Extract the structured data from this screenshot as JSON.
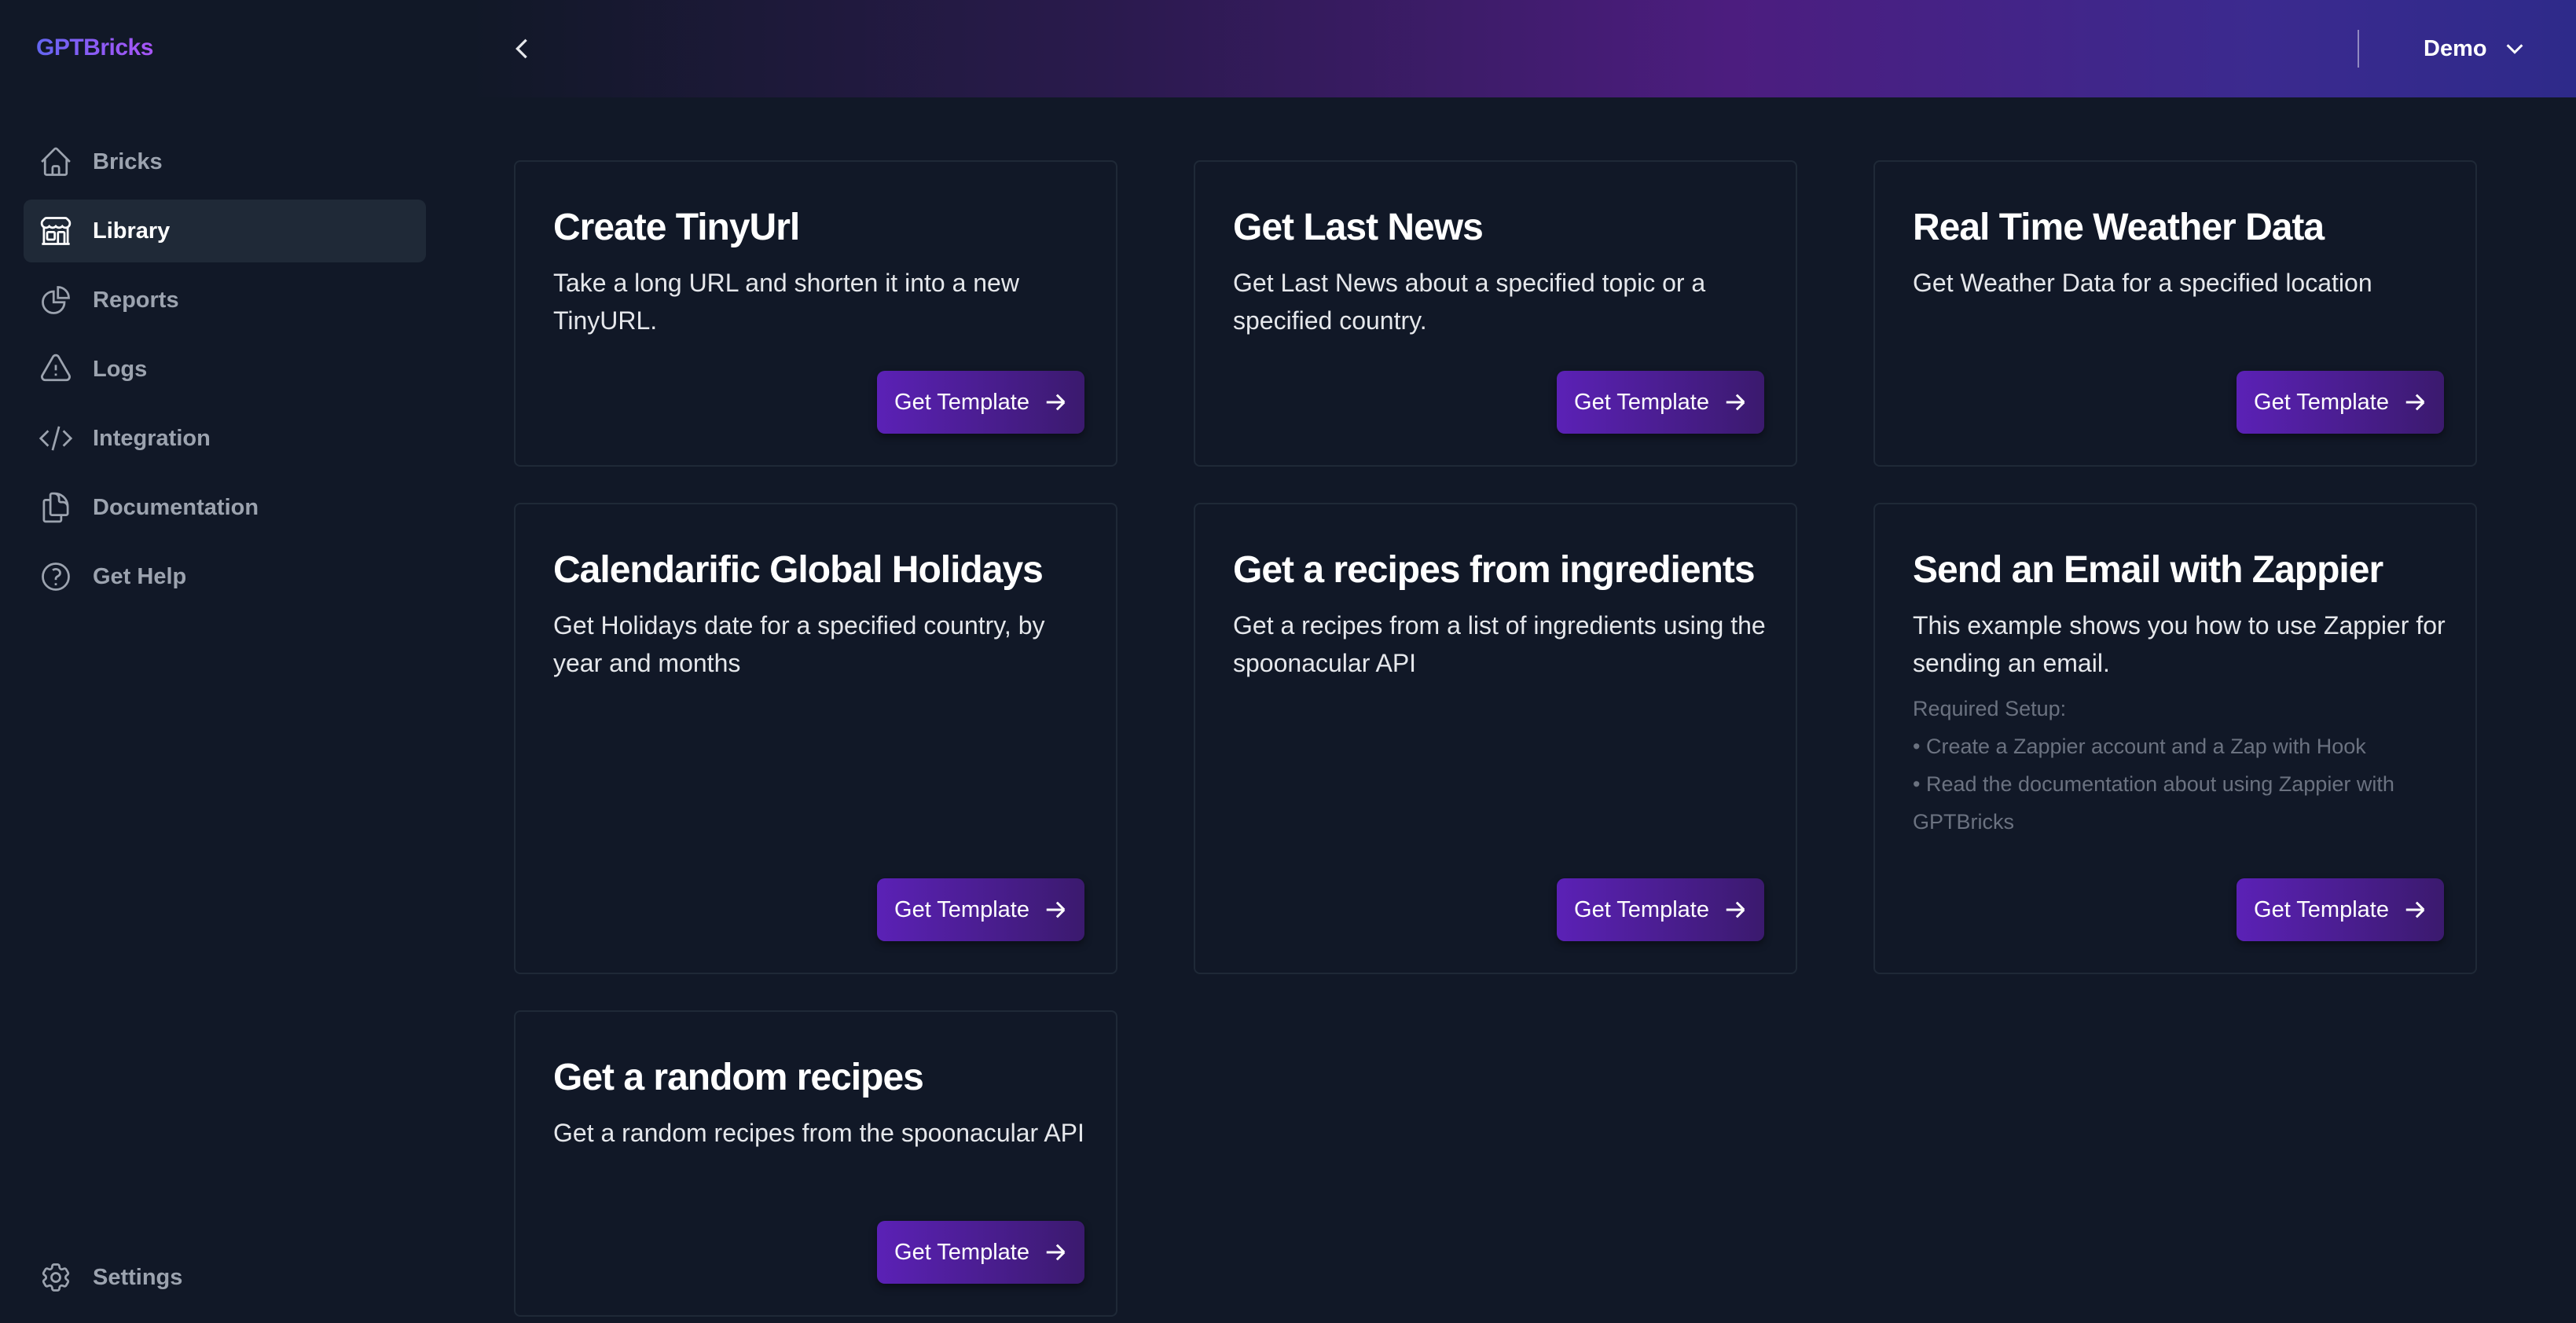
{
  "app": {
    "logo": "GPTBricks"
  },
  "sidebar": {
    "items": [
      {
        "label": "Bricks",
        "icon": "home-icon",
        "active": false
      },
      {
        "label": "Library",
        "icon": "storefront-icon",
        "active": true
      },
      {
        "label": "Reports",
        "icon": "pie-chart-icon",
        "active": false
      },
      {
        "label": "Logs",
        "icon": "warning-icon",
        "active": false
      },
      {
        "label": "Integration",
        "icon": "code-icon",
        "active": false
      },
      {
        "label": "Documentation",
        "icon": "documents-icon",
        "active": false
      },
      {
        "label": "Get Help",
        "icon": "question-circle-icon",
        "active": false
      }
    ],
    "settings_label": "Settings"
  },
  "header": {
    "user_label": "Demo"
  },
  "cards": [
    {
      "title": "Create TinyUrl",
      "description": "Take a long URL and shorten it into a new TinyURL.",
      "button": "Get Template"
    },
    {
      "title": "Get Last News",
      "description": "Get Last News about a specified topic or a specified country.",
      "button": "Get Template"
    },
    {
      "title": "Real Time Weather Data",
      "description": "Get Weather Data for a specified location",
      "button": "Get Template"
    },
    {
      "title": "Calendarific Global Holidays",
      "description": "Get Holidays date for a specified country, by year and months",
      "button": "Get Template"
    },
    {
      "title": "Get a recipes from ingredients",
      "description": "Get a recipes from a list of ingredients using the spoonacular API",
      "button": "Get Template"
    },
    {
      "title": "Send an Email with Zappier",
      "description": "This example shows you how to use Zappier for sending an email.",
      "button": "Get Template",
      "setup": {
        "heading": "Required Setup:",
        "steps": [
          "• Create a Zappier account and a Zap with Hook",
          "• Read the documentation about using Zappier with GPTBricks"
        ]
      }
    },
    {
      "title": "Get a random recipes",
      "description": "Get a random recipes from the spoonacular API",
      "button": "Get Template"
    }
  ],
  "colors": {
    "background": "#111827",
    "active_nav": "#1f2937",
    "button_start": "#5b21b6",
    "button_end": "#3b1a6e",
    "header_purple": "#4c1d7f"
  }
}
